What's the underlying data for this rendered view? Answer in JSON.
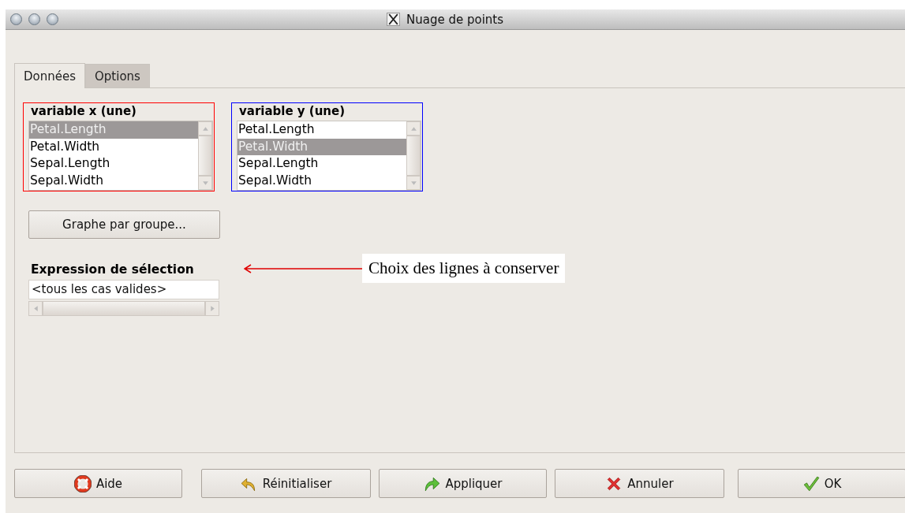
{
  "window": {
    "title": "Nuage de points"
  },
  "tabs": [
    {
      "label": "Données",
      "selected": true
    },
    {
      "label": "Options",
      "selected": false
    }
  ],
  "lists": [
    {
      "label": "variable x (une)",
      "color": "#ff0000",
      "items": [
        {
          "text": "Petal.Length",
          "selected": true
        },
        {
          "text": "Petal.Width",
          "selected": false
        },
        {
          "text": "Sepal.Length",
          "selected": false
        },
        {
          "text": "Sepal.Width",
          "selected": false
        }
      ]
    },
    {
      "label": "variable y (une)",
      "color": "#0000ff",
      "items": [
        {
          "text": "Petal.Length",
          "selected": false
        },
        {
          "text": "Petal.Width",
          "selected": true
        },
        {
          "text": "Sepal.Length",
          "selected": false
        },
        {
          "text": "Sepal.Width",
          "selected": false
        }
      ]
    }
  ],
  "group_button": "Graphe par groupe...",
  "selection": {
    "label": "Expression de sélection",
    "value": "<tous les cas valides>"
  },
  "annotation": {
    "text": "Choix des lignes à conserver"
  },
  "buttons": [
    {
      "label": "Aide",
      "kind": "help"
    },
    {
      "label": "Réinitialiser",
      "kind": "reset"
    },
    {
      "label": "Appliquer",
      "kind": "apply"
    },
    {
      "label": "Annuler",
      "kind": "cancel"
    },
    {
      "label": "OK",
      "kind": "ok"
    }
  ]
}
